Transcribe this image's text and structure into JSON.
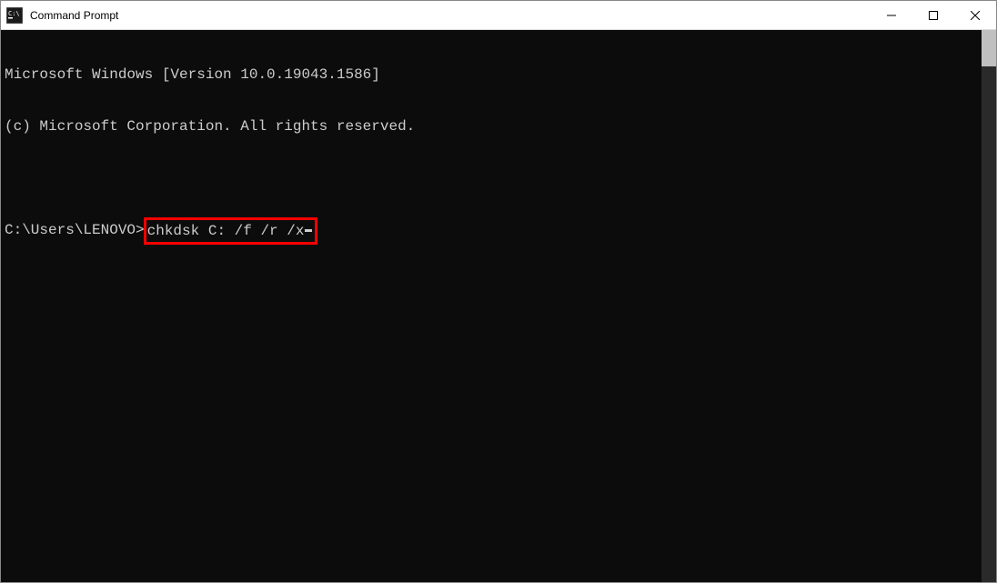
{
  "window": {
    "title": "Command Prompt"
  },
  "terminal": {
    "line1": "Microsoft Windows [Version 10.0.19043.1586]",
    "line2": "(c) Microsoft Corporation. All rights reserved.",
    "prompt": "C:\\Users\\LENOVO>",
    "command": "chkdsk C: /f /r /x"
  },
  "highlight": {
    "color": "#ff0000"
  }
}
